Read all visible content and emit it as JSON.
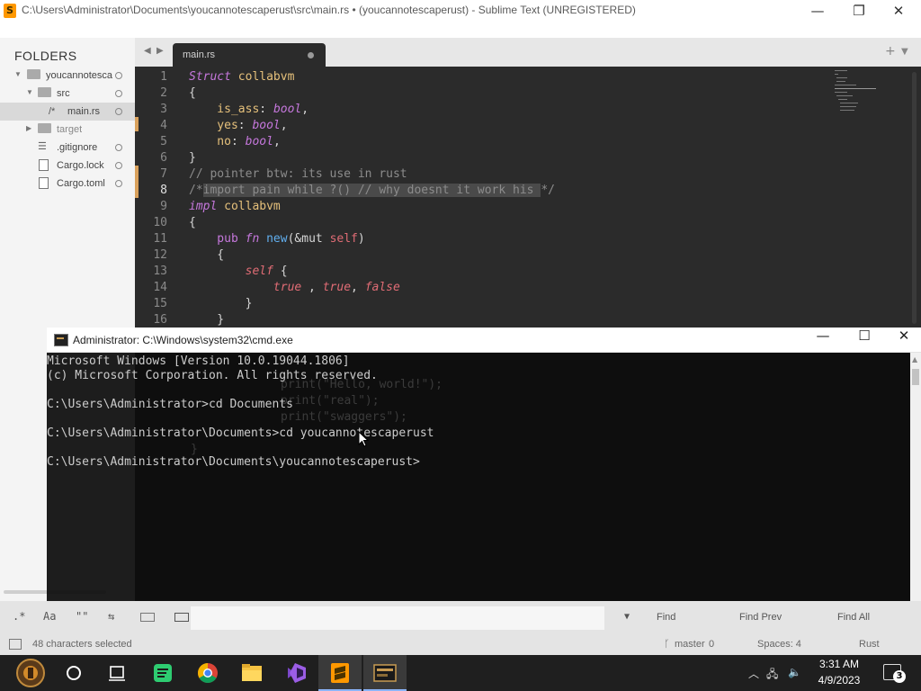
{
  "sublime": {
    "title": "C:\\Users\\Administrator\\Documents\\youcannotescaperust\\src\\main.rs • (youcannotescaperust) - Sublime Text (UNREGISTERED)",
    "folders_label": "FOLDERS",
    "tree": [
      {
        "label": "youcannotesca",
        "type": "folder"
      },
      {
        "label": "src",
        "type": "folder"
      },
      {
        "label": "main.rs",
        "type": "file",
        "prefix": "/*"
      },
      {
        "label": "target",
        "type": "folder"
      },
      {
        "label": ".gitignore",
        "type": "file"
      },
      {
        "label": "Cargo.lock",
        "type": "file"
      },
      {
        "label": "Cargo.toml",
        "type": "file"
      }
    ],
    "tab_name": "main.rs",
    "line_numbers": [
      "1",
      "2",
      "3",
      "4",
      "5",
      "6",
      "7",
      "8",
      "9",
      "10",
      "11",
      "12",
      "13",
      "14",
      "15",
      "16"
    ],
    "code_plain": {
      "l1a": "Struct",
      "l1b": " collabvm",
      "l2": "{",
      "l3a": "    is_ass",
      "l3b": ": ",
      "l3c": "bool",
      "l3d": ",",
      "l4a": "    yes",
      "l4b": ": ",
      "l4c": "bool",
      "l4d": ",",
      "l5a": "    no",
      "l5b": ": ",
      "l5c": "bool",
      "l5d": ",",
      "l6": "}",
      "l7": "// pointer btw: its use in rust",
      "l8a": "/*",
      "l8b": "import pain while ?() // why doesnt it work his ",
      "l8c": "*/",
      "l9a": "impl",
      "l9b": " collabvm",
      "l10": "{",
      "l11a": "    pub ",
      "l11b": "fn",
      "l11c": " new",
      "l11d": "(&mut ",
      "l11e": "self",
      "l11f": ")",
      "l12": "    {",
      "l13a": "        ",
      "l13b": "self",
      "l13c": " {",
      "l14a": "            ",
      "l14b": "true",
      "l14c": " , ",
      "l14d": "true",
      "l14e": ", ",
      "l14f": "false",
      "l15": "        }",
      "l16": "    }"
    },
    "ghost_lines": [
      "print(\"Hello, world!\");",
      "print(\"real\");",
      "print(\"swaggers\");",
      "}"
    ],
    "find": {
      "regex": ".*",
      "case": "Aa",
      "word": "\"\"",
      "wrap": "⇆",
      "find_label": "Find",
      "find_prev_label": "Find Prev",
      "find_all_label": "Find All"
    },
    "status": {
      "selection": "48 characters selected",
      "branch": "master",
      "branch_count": "0",
      "spaces": "Spaces: 4",
      "syntax": "Rust"
    }
  },
  "cmd": {
    "title": "Administrator: C:\\Windows\\system32\\cmd.exe",
    "lines": [
      "Microsoft Windows [Version 10.0.19044.1806]",
      "(c) Microsoft Corporation. All rights reserved.",
      "",
      "C:\\Users\\Administrator>cd Documents",
      "",
      "C:\\Users\\Administrator\\Documents>cd youcannotescaperust",
      "",
      "C:\\Users\\Administrator\\Documents\\youcannotescaperust>"
    ]
  },
  "taskbar": {
    "apps": [
      "start-button",
      "search-button",
      "task-view-button",
      "spotify-app",
      "chrome-app",
      "file-explorer-app",
      "visual-studio-app",
      "sublime-app",
      "cmd-app"
    ],
    "time": "3:31 AM",
    "date": "4/9/2023",
    "notification_count": "3"
  },
  "colors": {
    "accent": "#ff9800",
    "editor_bg": "#2b2b2b",
    "keyword": "#c678dd",
    "boolean": "#e06c75"
  }
}
